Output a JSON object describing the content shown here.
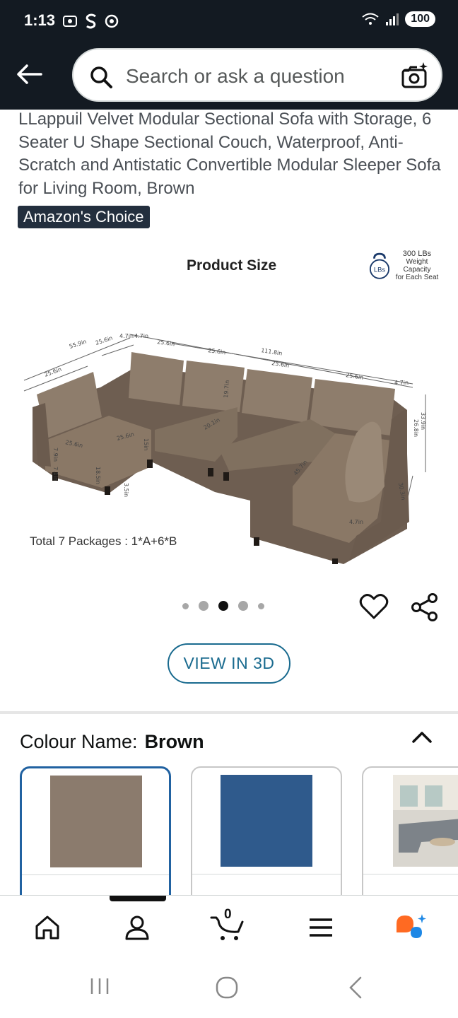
{
  "status_bar": {
    "time": "1:13",
    "battery": "100"
  },
  "search": {
    "placeholder": "Search or ask a question"
  },
  "product": {
    "title": "LLappuil Velvet Modular Sectional Sofa with Storage, 6 Seater U Shape Sectional Couch, Waterproof, Anti-Scratch and Antistatic Convertible Modular Sleeper Sofa for Living Room, Brown",
    "badge": "Amazon's Choice",
    "image": {
      "title": "Product Size",
      "weight_badge_icon": "LBs",
      "weight_value": "300 LBs",
      "weight_caption_1": "Weight Capacity",
      "weight_caption_2": "for Each Seat",
      "packages": "Total 7 Packages : 1*A+6*B",
      "dimension_labels": [
        "55.9in",
        "25.6in",
        "4.7in",
        "4.7in",
        "25.6in",
        "25.6in",
        "111.8in",
        "25.6in",
        "25.6in",
        "4.7in",
        "25.6in",
        "19.7in",
        "20.1in",
        "25.6in",
        "25.6in",
        "15in",
        "7.9in",
        "7.1in",
        "18.5in",
        "3.5in",
        "45.7in",
        "33.9in",
        "26.8in",
        "30.3in",
        "4.7in"
      ]
    },
    "carousel": {
      "total": 5,
      "active_index": 2
    },
    "view_3d_label": "VIEW IN 3D"
  },
  "colour": {
    "label": "Colour Name:",
    "value": "Brown",
    "swatches": [
      {
        "color": "#8b7b6d",
        "selected": true
      },
      {
        "color": "#2f5a8c",
        "selected": false
      },
      {
        "color": "#9aa0a5",
        "selected": false
      }
    ]
  },
  "bottom_nav": {
    "cart_count": "0",
    "items": [
      "home-icon",
      "account-icon",
      "cart-icon",
      "menu-icon",
      "rufus-icon"
    ]
  },
  "colors": {
    "header_bg": "#131a22",
    "badge_bg": "#232f3e",
    "link_blue": "#1a6b8f",
    "selected_border": "#2162a1",
    "rufus_orange": "#ff6a22",
    "rufus_blue": "#1e88e5"
  }
}
